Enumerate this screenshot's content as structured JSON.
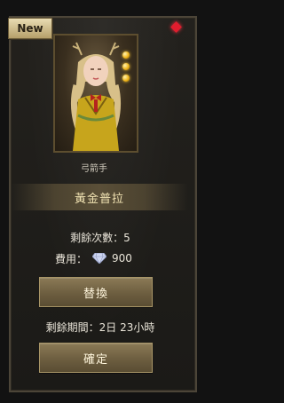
{
  "badge": {
    "new_label": "New"
  },
  "hero": {
    "job": "弓箭手",
    "name": "黃金普拉",
    "rank_dots": 3
  },
  "info": {
    "remaining_label": "剩餘次數：5",
    "cost_label": "費用：",
    "cost_value": "900",
    "cost_icon": "diamond-icon",
    "period_label": "剩餘期間：2日 23小時"
  },
  "buttons": {
    "swap_label": "替換",
    "confirm_label": "確定"
  },
  "colors": {
    "accent_gold": "#f0e2b2",
    "button": "#6d5e40",
    "gem": "#e11d2e"
  }
}
